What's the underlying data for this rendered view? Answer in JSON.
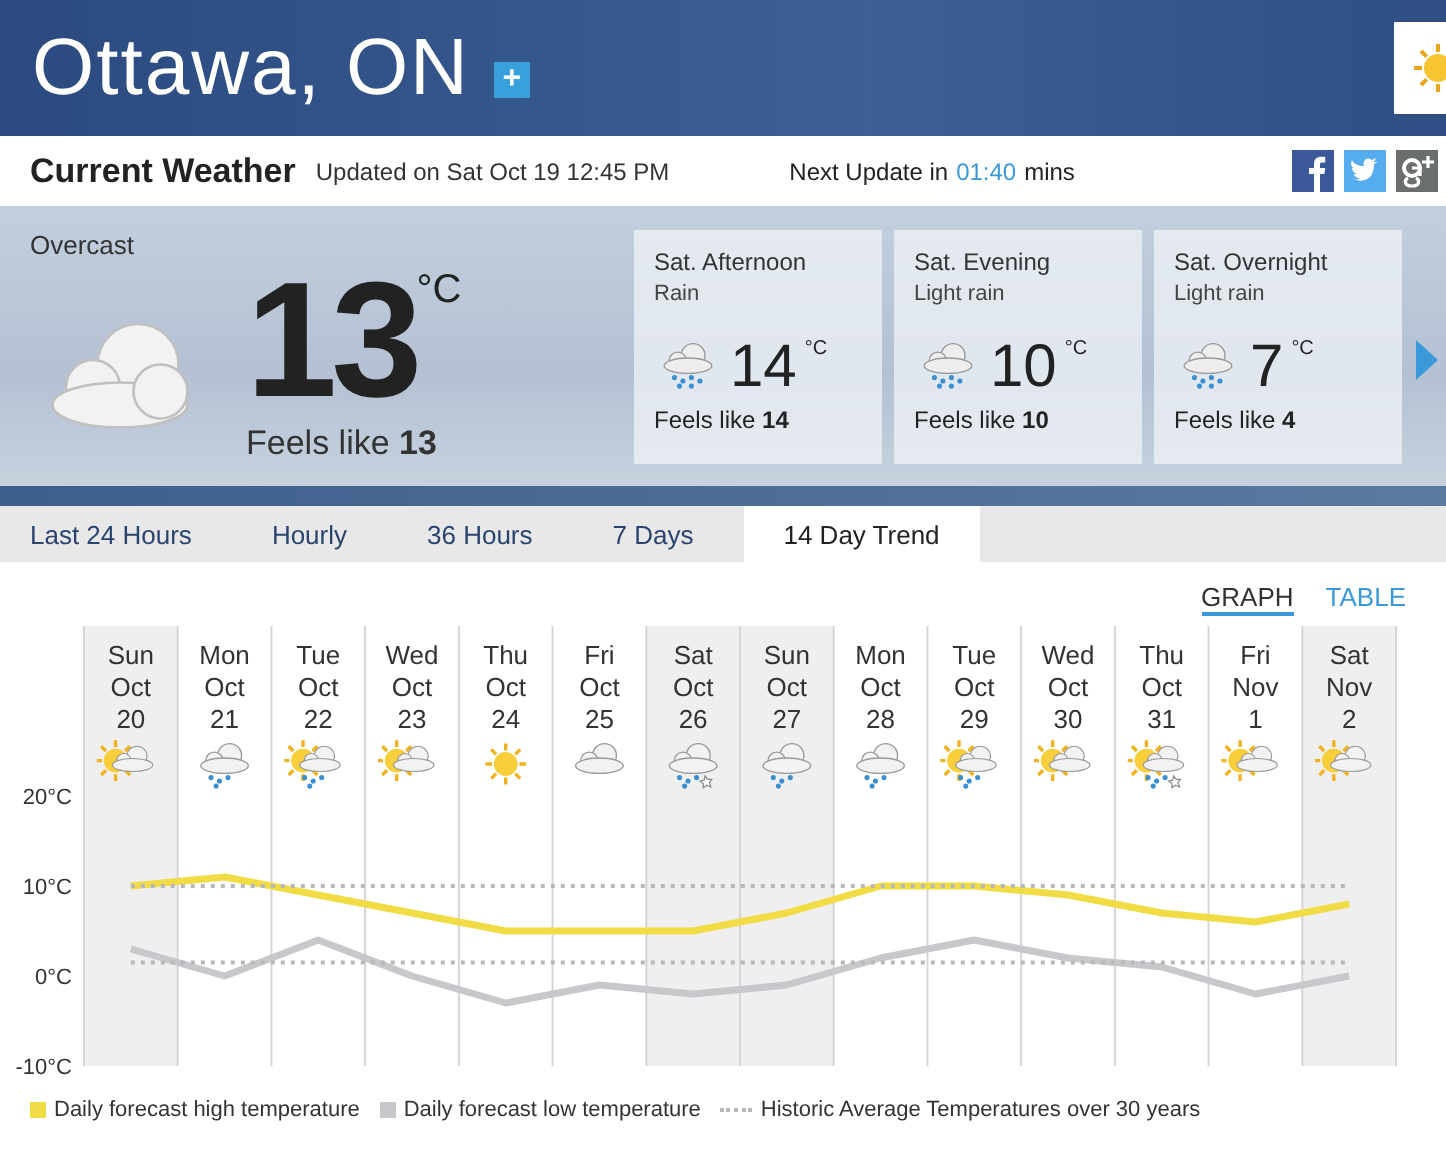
{
  "header": {
    "city": "Ottawa, ON",
    "add_button": "+"
  },
  "info_bar": {
    "title": "Current Weather",
    "updated": "Updated on Sat Oct 19 12:45 PM",
    "next_update_label": "Next Update in",
    "next_update_time": "01:40",
    "next_update_unit": "mins"
  },
  "current": {
    "condition": "Overcast",
    "kind": "cloud",
    "temperature": "13",
    "unit": "°C",
    "feels_like": "Feels like **13**"
  },
  "forecast_cards": [
    {
      "title": "Sat. Afternoon",
      "condition": "Rain",
      "kind": "rain",
      "temperature": "14",
      "unit": "°C",
      "feels_like": "Feels like **14**"
    },
    {
      "title": "Sat. Evening",
      "condition": "Light rain",
      "kind": "rain",
      "temperature": "10",
      "unit": "°C",
      "feels_like": "Feels like **10**"
    },
    {
      "title": "Sat. Overnight",
      "condition": "Light rain",
      "kind": "rain",
      "temperature": "7",
      "unit": "°C",
      "feels_like": "Feels like **4**"
    }
  ],
  "tabs": [
    {
      "label": "Last 24 Hours",
      "selected": false
    },
    {
      "label": "Hourly",
      "selected": false
    },
    {
      "label": "36 Hours",
      "selected": false
    },
    {
      "label": "7 Days",
      "selected": false
    },
    {
      "label": "14 Day Trend",
      "selected": true
    }
  ],
  "view_toggle": [
    {
      "label": "GRAPH",
      "selected": true
    },
    {
      "label": "TABLE",
      "selected": false
    }
  ],
  "days": [
    {
      "weekend": true,
      "kind": "sun_cloud"
    },
    {
      "weekend": false,
      "kind": "rain"
    },
    {
      "weekend": false,
      "kind": "sun_cloud_rain"
    },
    {
      "weekend": false,
      "kind": "sun_cloud"
    },
    {
      "weekend": false,
      "kind": "sun"
    },
    {
      "weekend": false,
      "kind": "cloud"
    },
    {
      "weekend": true,
      "kind": "snow_rain"
    },
    {
      "weekend": true,
      "kind": "rain"
    },
    {
      "weekend": false,
      "kind": "rain"
    },
    {
      "weekend": false,
      "kind": "sun_cloud_rain"
    },
    {
      "weekend": false,
      "kind": "sun_cloud"
    },
    {
      "weekend": false,
      "kind": "sun_cloud_snow"
    },
    {
      "weekend": false,
      "kind": "sun_cloud"
    },
    {
      "weekend": true,
      "kind": "sun_cloud"
    }
  ],
  "chart_data": {
    "type": "line",
    "categories": [
      "Sun Oct 20",
      "Mon Oct 21",
      "Tue Oct 22",
      "Wed Oct 23",
      "Thu Oct 24",
      "Fri Oct 25",
      "Sat Oct 26",
      "Sun Oct 27",
      "Mon Oct 28",
      "Tue Oct 29",
      "Wed Oct 30",
      "Thu Oct 31",
      "Fri Nov 1",
      "Sat Nov 2"
    ],
    "ylim": [
      -10,
      20
    ],
    "yticks": [
      {
        "value": 20,
        "label": "20°C"
      },
      {
        "value": 10,
        "label": "10°C"
      },
      {
        "value": 0,
        "label": "0°C"
      },
      {
        "value": -10,
        "label": "-10°C"
      }
    ],
    "series": [
      {
        "name": "Daily forecast high temperature",
        "color": "#f2dc45",
        "line_style": "solid",
        "values": [
          10,
          11,
          9,
          7,
          5,
          5,
          5,
          7,
          10,
          10,
          9,
          7,
          6,
          8
        ]
      },
      {
        "name": "Daily forecast low temperature",
        "color": "#c8c8cc",
        "line_style": "solid",
        "values": [
          3,
          0,
          4,
          0,
          -3,
          -1,
          -2,
          -1,
          2,
          4,
          2,
          1,
          -2,
          0
        ]
      },
      {
        "name": "Historic Average Temperatures over 30 years",
        "color": "#b8b8b8",
        "line_style": "dotted",
        "values": [
          10,
          10,
          10,
          10,
          10,
          10,
          10,
          10,
          10,
          10,
          10,
          10,
          10,
          10
        ]
      },
      {
        "color": "#b8b8b8",
        "line_style": "dotted",
        "values": [
          1.5,
          1.5,
          1.5,
          1.5,
          1.5,
          1.5,
          1.5,
          1.5,
          1.5,
          1.5,
          1.5,
          1.5,
          1.5,
          1.5
        ]
      }
    ]
  }
}
